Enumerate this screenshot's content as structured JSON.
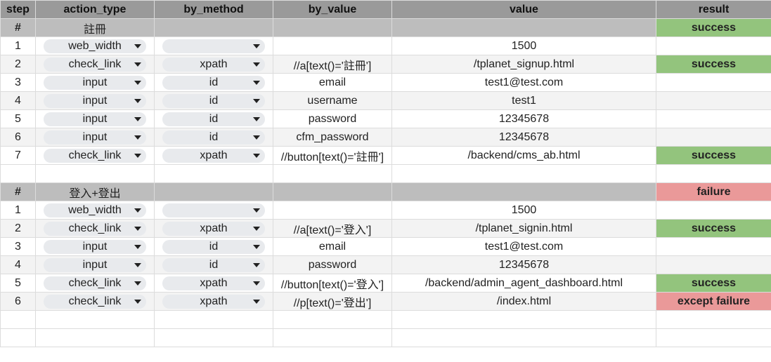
{
  "columns": [
    "step",
    "action_type",
    "by_method",
    "by_value",
    "value",
    "result"
  ],
  "sections": [
    {
      "header": {
        "step": "#",
        "name": "註冊",
        "result": "success",
        "status": "ok"
      },
      "rows": [
        {
          "step": "1",
          "action": "web_width",
          "method": "",
          "by_value": "",
          "value": "1500",
          "result": "",
          "status": ""
        },
        {
          "step": "2",
          "action": "check_link",
          "method": "xpath",
          "by_value": "//a[text()='註冊']",
          "value": "/tplanet_signup.html",
          "result": "success",
          "status": "ok"
        },
        {
          "step": "3",
          "action": "input",
          "method": "id",
          "by_value": "email",
          "value": "test1@test.com",
          "result": "",
          "status": ""
        },
        {
          "step": "4",
          "action": "input",
          "method": "id",
          "by_value": "username",
          "value": "test1",
          "result": "",
          "status": ""
        },
        {
          "step": "5",
          "action": "input",
          "method": "id",
          "by_value": "password",
          "value": "12345678",
          "result": "",
          "status": ""
        },
        {
          "step": "6",
          "action": "input",
          "method": "id",
          "by_value": "cfm_password",
          "value": "12345678",
          "result": "",
          "status": ""
        },
        {
          "step": "7",
          "action": "check_link",
          "method": "xpath",
          "by_value": "//button[text()='註冊']",
          "value": "/backend/cms_ab.html",
          "result": "success",
          "status": "ok"
        }
      ]
    },
    {
      "header": {
        "step": "#",
        "name": "登入+登出",
        "result": "failure",
        "status": "bad"
      },
      "rows": [
        {
          "step": "1",
          "action": "web_width",
          "method": "",
          "by_value": "",
          "value": "1500",
          "result": "",
          "status": ""
        },
        {
          "step": "2",
          "action": "check_link",
          "method": "xpath",
          "by_value": "//a[text()='登入']",
          "value": "/tplanet_signin.html",
          "result": "success",
          "status": "ok"
        },
        {
          "step": "3",
          "action": "input",
          "method": "id",
          "by_value": "email",
          "value": "test1@test.com",
          "result": "",
          "status": ""
        },
        {
          "step": "4",
          "action": "input",
          "method": "id",
          "by_value": "password",
          "value": "12345678",
          "result": "",
          "status": ""
        },
        {
          "step": "5",
          "action": "check_link",
          "method": "xpath",
          "by_value": "//button[text()='登入']",
          "value": "/backend/admin_agent_dashboard.html",
          "result": "success",
          "status": "ok"
        },
        {
          "step": "6",
          "action": "check_link",
          "method": "xpath",
          "by_value": "//p[text()='登出']",
          "value": "/index.html",
          "result": "except failure",
          "status": "bad"
        }
      ]
    }
  ],
  "colors": {
    "header_bg": "#9a9a9a",
    "section_bg": "#bdbdbd",
    "success_bg": "#93c47d",
    "failure_bg": "#ea9999",
    "chip_bg": "#e8eaed"
  }
}
